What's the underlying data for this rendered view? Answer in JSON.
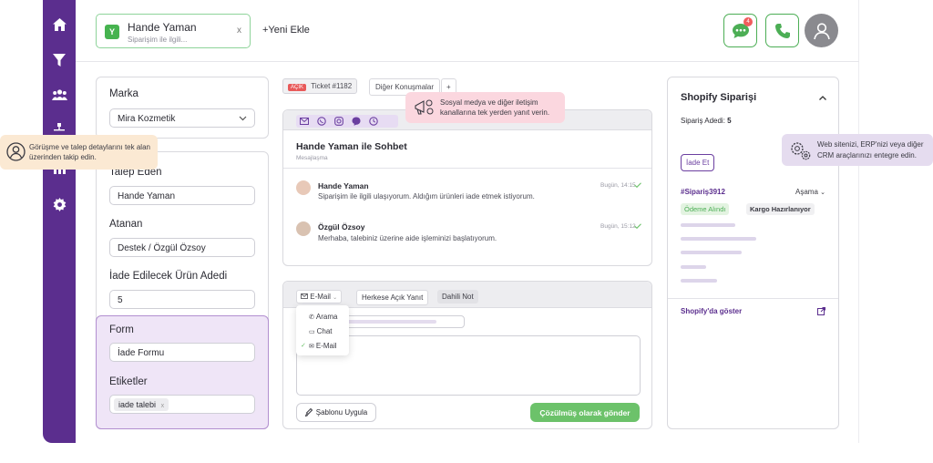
{
  "header": {
    "contact_name": "Hande Yaman",
    "contact_sub": "Siparişim ile ilgili...",
    "contact_initial": "Y",
    "close": "x",
    "new_tab": "+Yeni Ekle",
    "chat_badge": "4"
  },
  "left": {
    "brand_label": "Marka",
    "brand_value": "Mira Kozmetik",
    "requester_label": "Talep Eden",
    "requester_value": "Hande Yaman",
    "assignee_label": "Atanan",
    "assignee_value": "Destek / Özgül Özsoy",
    "qty_label": "İade Edilecek Ürün Adedi",
    "qty_value": "5",
    "form_label": "Form",
    "form_value": "İade Formu",
    "tags_label": "Etiketler",
    "tag": "iade talebi",
    "tag_x": "x"
  },
  "tickets": {
    "status": "AÇIK",
    "ticket": "Ticket #1182",
    "other": "Diğer Konuşmalar",
    "plus": "+"
  },
  "conversation": {
    "title": "Hande Yaman ile Sohbet",
    "subtitle": "Mesajlaşma",
    "messages": [
      {
        "name": "Hande Yaman",
        "text": "Siparişim ile ilgili ulaşıyorum. Aldığım ürünleri iade etmek istiyorum.",
        "time": "Bugün, 14:15"
      },
      {
        "name": "Özgül Özsoy",
        "text": "Merhaba, talebiniz üzerine aide işleminizi başlatıyorum.",
        "time": "Bugün, 15:12"
      }
    ]
  },
  "reply": {
    "channel": "E-Mail",
    "public": "Herkese Açık Yanıt",
    "internal": "Dahili Not",
    "options": [
      "Arama",
      "Chat",
      "E-Mail"
    ],
    "template_btn": "Şablonu Uygula",
    "send_btn": "Çözülmüş olarak gönder"
  },
  "shopify": {
    "title": "Shopify Siparişi",
    "count_label": "Sipariş Adedi:",
    "count_value": "5",
    "refund_btn": "İade Et",
    "order_id": "#Sipariş3912",
    "stage": "Aşama",
    "paid": "Ödeme Alındı",
    "cargo": "Kargo Hazırlanıyor",
    "show_link": "Shopify'da göster"
  },
  "tooltips": {
    "left": "Görüşme ve talep detaylarını tek alan üzerinden takip edin.",
    "middle": "Sosyal medya ve diğer iletişim kanallarına tek yerden yanıt verin.",
    "right": "Web sitenizi, ERP'nizi veya diğer CRM araçlarınızı entegre edin."
  },
  "colors": {
    "sidebar": "#5b2e8e",
    "accent_green": "#4cae55",
    "form_bg": "#efe5f7",
    "tooltip_pink": "#fbd7df",
    "tooltip_peach": "#fbe9d3",
    "tooltip_lilac": "#e5dcef"
  }
}
